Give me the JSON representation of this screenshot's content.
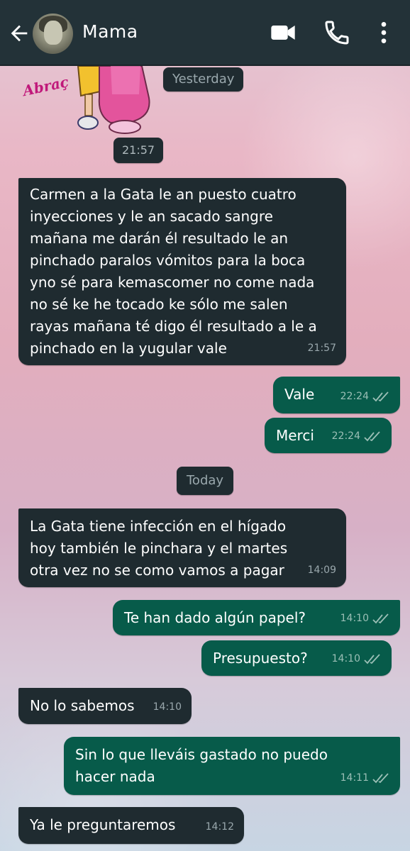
{
  "header": {
    "contact_name": "Mama",
    "back_icon": "back-arrow-icon",
    "video_icon": "video-call-icon",
    "phone_icon": "phone-call-icon",
    "menu_icon": "more-options-icon",
    "bar_color": "#233238"
  },
  "sticker": {
    "text_fragment": "Abraç"
  },
  "dates": {
    "yesterday": "Yesterday",
    "today": "Today"
  },
  "messages": [
    {
      "dir": "in",
      "time": "21:57",
      "sticker_time": true
    },
    {
      "dir": "in",
      "text": "Carmen a la Gata le an puesto cuatro\ninyecciones y le an sacado sangre\nmañana me darán él resultado le an\npinchado paralos vómitos para la boca\nyno sé para kemascomer no come nada\nno sé ke he tocado ke sólo me salen\nrayas mañana té digo él resultado a le a\npinchado en la yugular vale",
      "time": "21:57"
    },
    {
      "dir": "out",
      "text": "Vale",
      "time": "22:24",
      "status": "read"
    },
    {
      "dir": "out",
      "text": "Merci",
      "time": "22:24",
      "status": "read"
    },
    {
      "dir": "in",
      "text": "La Gata tiene infección en el hígado\nhoy también le pinchara y el martes\notra vez no se como vamos a pagar",
      "time": "14:09"
    },
    {
      "dir": "out",
      "text": "Te han dado algún papel?",
      "time": "14:10",
      "status": "read"
    },
    {
      "dir": "out",
      "text": "Presupuesto?",
      "time": "14:10",
      "status": "read"
    },
    {
      "dir": "in",
      "text": "No lo sabemos",
      "time": "14:10"
    },
    {
      "dir": "out",
      "text": "Sin  lo que lleváis gastado no puedo\nhacer nada",
      "time": "14:11",
      "status": "read"
    },
    {
      "dir": "in",
      "text": "Ya le preguntaremos",
      "time": "14:12"
    }
  ],
  "colors": {
    "incoming_bubble": "#1f2b30",
    "outgoing_bubble": "#075b4a",
    "meta_text": "#9aa8ad"
  }
}
